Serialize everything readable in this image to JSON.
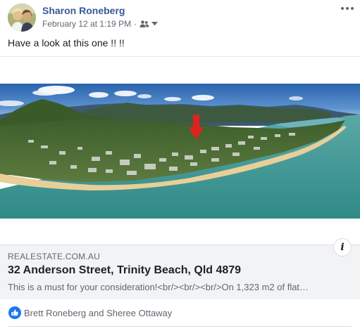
{
  "post": {
    "author": "Sharon Roneberg",
    "timestamp": "February 12 at 1:19 PM",
    "separator": "·",
    "audience_icon": "friends-icon",
    "message": "Have a look at this one !! !!"
  },
  "link_preview": {
    "domain": "REALESTATE.COM.AU",
    "title": "32 Anderson Street, Trinity Beach, Qld 4879",
    "description": "This is a must for your consideration!<br/><br/><br/>On 1,323 m2 of flat…",
    "info_label": "i",
    "image_icon": "aerial-beach-photo"
  },
  "reactions": {
    "icon": "like-icon",
    "text": "Brett Roneberg and Sheree Ottaway"
  },
  "colors": {
    "author_link": "#385898",
    "secondary_text": "#606770",
    "link_box_bg": "#f2f3f5",
    "like_blue": "#1877f2",
    "sea": "#3f9a96",
    "sand": "#e8cf98",
    "sky": "#2f6fb8"
  }
}
